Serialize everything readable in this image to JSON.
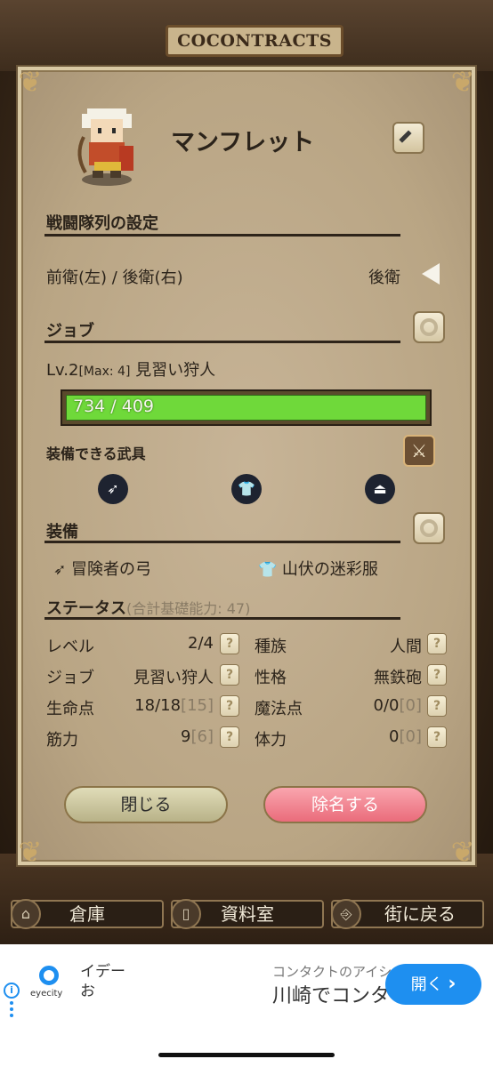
{
  "background": {
    "sign_text": "COCONTRACTS"
  },
  "character": {
    "name": "マンフレット"
  },
  "formation": {
    "heading": "戦闘隊列の設定",
    "label": "前衛(左) / 後衛(右)",
    "value": "後衛"
  },
  "job": {
    "heading": "ジョブ",
    "level": "Lv.2",
    "max": "[Max: 4]",
    "name": "見習い狩人",
    "exp_text": "734 / 409",
    "exp_fraction": 1.0
  },
  "weapons": {
    "heading": "装備できる武具",
    "icons": [
      "bow-icon",
      "shirt-icon",
      "accessory-icon"
    ]
  },
  "equipment": {
    "heading": "装備",
    "items": [
      {
        "icon": "bow-icon",
        "label": "冒険者の弓"
      },
      {
        "icon": "shirt-icon",
        "label": "山伏の迷彩服"
      }
    ]
  },
  "status": {
    "heading": "ステータス",
    "sub": "(合計基礎能力: 47)",
    "rows": [
      {
        "label": "レベル",
        "value": "2/4",
        "bonus": ""
      },
      {
        "label": "ジョブ",
        "value": "見習い狩人",
        "bonus": ""
      },
      {
        "label": "生命点",
        "value": "18/18",
        "bonus": "[15]"
      },
      {
        "label": "筋力",
        "value": "9",
        "bonus": "[6]"
      }
    ],
    "rows_right": [
      {
        "label": "種族",
        "value": "人間",
        "bonus": ""
      },
      {
        "label": "性格",
        "value": "無鉄砲",
        "bonus": ""
      },
      {
        "label": "魔法点",
        "value": "0/0",
        "bonus": "[0]"
      },
      {
        "label": "体力",
        "value": "0",
        "bonus": "[0]"
      }
    ],
    "help": "?"
  },
  "buttons": {
    "close": "閉じる",
    "dismiss": "除名する"
  },
  "nav": {
    "warehouse": "倉庫",
    "archive": "資料室",
    "return": "街に戻る"
  },
  "ad": {
    "brand": "eyecity",
    "line1a": "イデー",
    "line1b": "お",
    "line2a": "コンタクトのアイシ",
    "line2b": "川崎でコンタ",
    "cta": "開く",
    "cta_arrow": "›",
    "info": "i"
  },
  "colors": {
    "exp_bar": "#6fd93a",
    "dismiss_button": "#f07b88",
    "close_button": "#c9c49a",
    "ad_cta": "#1e8ff0"
  }
}
